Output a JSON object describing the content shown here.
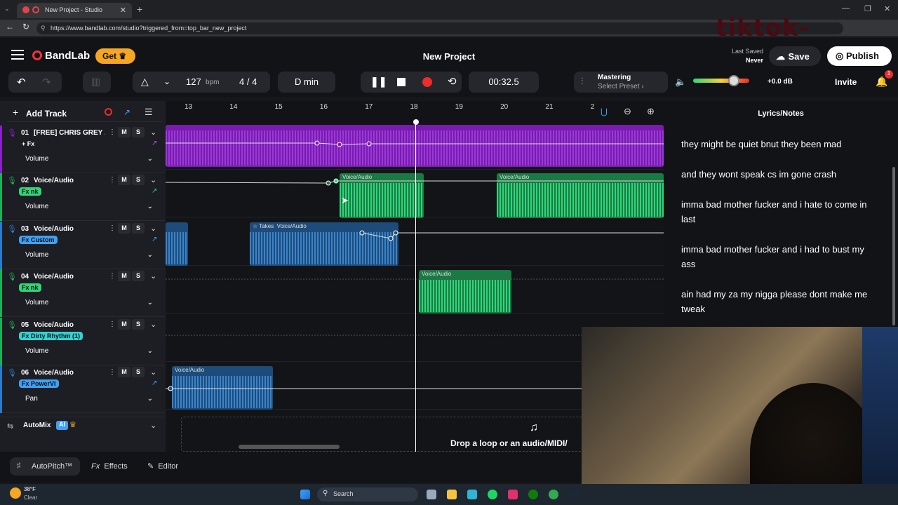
{
  "browser": {
    "tab_title": "New Project - Studio",
    "url": "https://www.bandlab.com/studio?triggered_from=top_bar_new_project"
  },
  "overlay_text": "tiktok-ynroyy",
  "header": {
    "brand": "BandLab",
    "get_label": "Get",
    "project_title": "New Project",
    "last_saved_label": "Last Saved",
    "last_saved_value": "Never",
    "save_label": "Save",
    "publish_label": "Publish"
  },
  "transport": {
    "bpm_value": "127",
    "bpm_unit": "bpm",
    "time_sig": "4 / 4",
    "key": "D min",
    "time": "00:32.5",
    "mastering_label": "Mastering",
    "mastering_preset": "Select Preset ›",
    "volume_db": "+0.0 dB",
    "invite_label": "Invite",
    "notif_count": "1",
    "master_volume": 0.72
  },
  "track_panel": {
    "add_track_label": "Add Track",
    "automix_label": "AutoMix",
    "automix_badge": "AI"
  },
  "ruler": [
    "13",
    "14",
    "15",
    "16",
    "17",
    "18",
    "19",
    "20",
    "21",
    "2"
  ],
  "tracks": [
    {
      "number": "01",
      "name": "[FREE] CHRIS GREY ...",
      "fx": "+ Fx",
      "fx_color": "",
      "param": "Volume",
      "color": "#8b1fc7"
    },
    {
      "number": "02",
      "name": "Voice/Audio",
      "fx": "Fx nk",
      "fx_color": "#2fd67a",
      "param": "Volume",
      "color": "#1fae5a"
    },
    {
      "number": "03",
      "name": "Voice/Audio",
      "fx": "Fx Custom",
      "fx_color": "#3fa0f5",
      "param": "Volume",
      "color": "#2a7cc9"
    },
    {
      "number": "04",
      "name": "Voice/Audio",
      "fx": "Fx nk",
      "fx_color": "#2fd67a",
      "param": "Volume",
      "color": "#1fae5a"
    },
    {
      "number": "05",
      "name": "Voice/Audio",
      "fx": "Fx Dirty Rhythm (1)",
      "fx_color": "#33d3d3",
      "param": "Volume",
      "color": "#1fae5a"
    },
    {
      "number": "06",
      "name": "Voice/Audio",
      "fx": "Fx PowerVI",
      "fx_color": "#3fa0f5",
      "param": "Pan",
      "color": "#2a7cc9"
    }
  ],
  "mute_label": "M",
  "solo_label": "S",
  "clips": {
    "voice_audio": "Voice/Audio",
    "takes": "Takes"
  },
  "drop_text": "Drop a loop or an audio/MIDI/",
  "lyrics": {
    "title": "Lyrics/Notes",
    "lines": [
      "they might be quiet bnut they been mad",
      "and they wont speak cs im gone crash",
      "imma bad mother fucker and i hate to come in last",
      "imma bad mother fucker and i had to bust my ass",
      "ain had my za my nigga please dont make me tweak"
    ]
  },
  "bottom": {
    "autopitch": "AutoPitch™",
    "effects": "Effects",
    "editor": "Editor"
  },
  "taskbar": {
    "temp": "38°F",
    "weather": "Clear",
    "search": "Search"
  }
}
